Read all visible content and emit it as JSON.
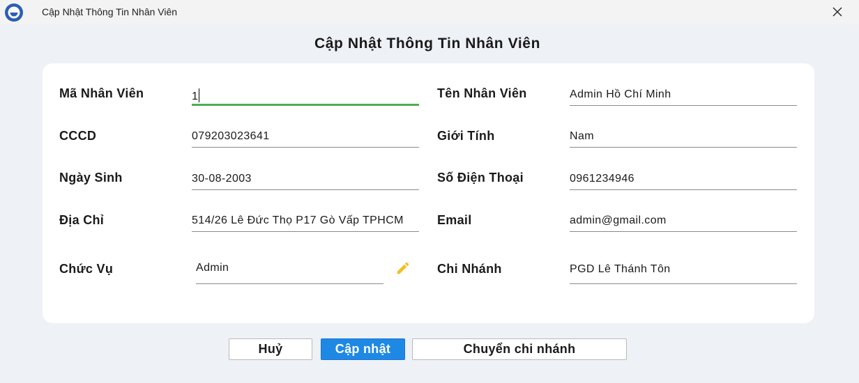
{
  "window": {
    "title": "Cập Nhật Thông Tin Nhân Viên",
    "logo_icon": "app-logo-icon",
    "close_icon": "close-icon"
  },
  "form": {
    "heading": "Cập Nhật Thông Tin Nhân Viên",
    "ma_nv": {
      "label": "Mã Nhân Viên",
      "value": "1"
    },
    "ten_nv": {
      "label": "Tên Nhân Viên",
      "value": "Admin Hồ Chí Minh"
    },
    "cccd": {
      "label": "CCCD",
      "value": "079203023641"
    },
    "gioi_tinh": {
      "label": "Giới Tính",
      "value": "Nam"
    },
    "ngay_sinh": {
      "label": "Ngày Sinh",
      "value": "30-08-2003"
    },
    "sdt": {
      "label": "Số Điện Thoại",
      "value": "0961234946"
    },
    "dia_chi": {
      "label": "Địa Chỉ",
      "value": "514/26 Lê Đức Thọ P17 Gò Vấp TPHCM"
    },
    "email": {
      "label": "Email",
      "value": "admin@gmail.com"
    },
    "chuc_vu": {
      "label": "Chức Vụ",
      "value": "Admin",
      "edit_icon": "pencil-icon"
    },
    "chi_nhanh": {
      "label": "Chi Nhánh",
      "value": "PGD Lê Thánh Tôn"
    }
  },
  "buttons": {
    "cancel": "Huỷ",
    "update": "Cập nhật",
    "transfer": "Chuyển chi nhánh"
  },
  "colors": {
    "accent": "#1e88e5",
    "active_underline": "#4caf50",
    "edit_icon": "#f0c020"
  }
}
